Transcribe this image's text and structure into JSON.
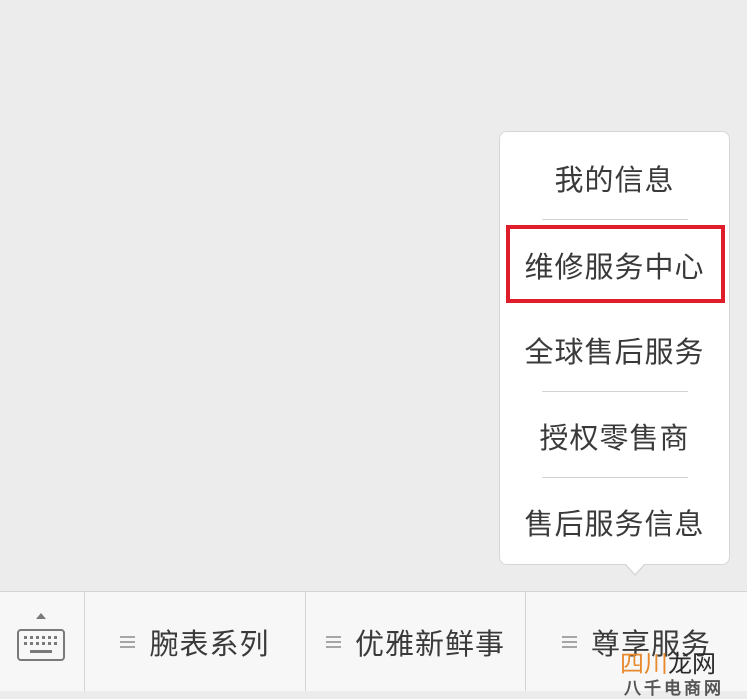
{
  "menu": {
    "items": [
      {
        "label": "我的信息"
      },
      {
        "label": "维修服务中心"
      },
      {
        "label": "全球售后服务"
      },
      {
        "label": "授权零售商"
      },
      {
        "label": "售后服务信息"
      }
    ],
    "highlight_color": "#e01e2b"
  },
  "bottom_bar": {
    "keyboard_icon": "keyboard-icon",
    "tabs": [
      {
        "label": "腕表系列",
        "icon": "menu-lines-icon"
      },
      {
        "label": "优雅新鲜事",
        "icon": "menu-lines-icon"
      },
      {
        "label": "尊享服务",
        "icon": "menu-lines-icon"
      }
    ]
  },
  "watermark": {
    "line1_a": "四川",
    "line1_b": "龙网",
    "line2": "八千电商网"
  }
}
